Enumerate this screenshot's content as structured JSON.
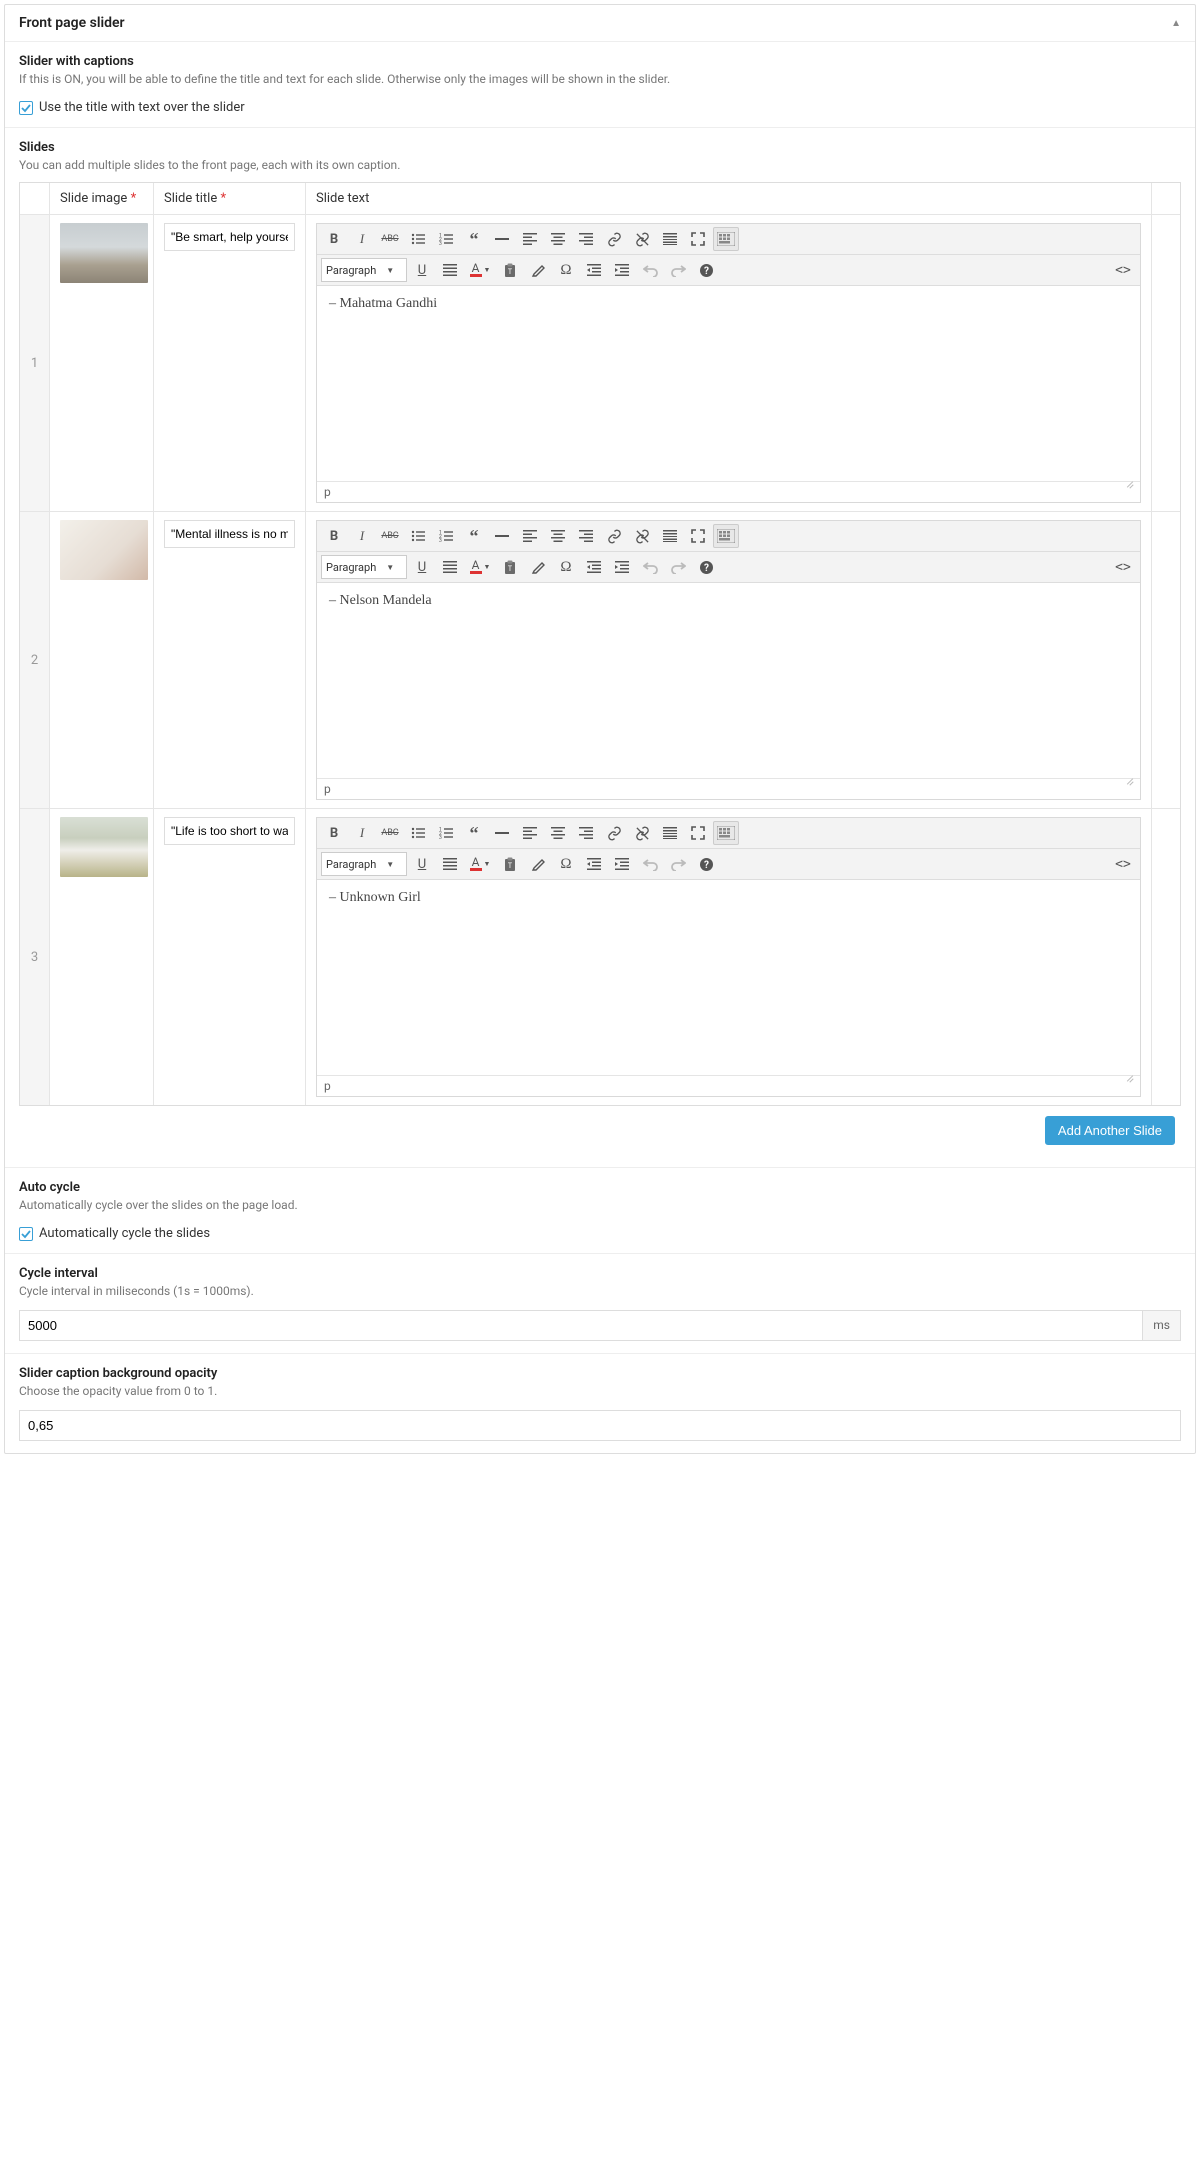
{
  "panel": {
    "title": "Front page slider"
  },
  "captions": {
    "title": "Slider with captions",
    "desc": "If this is ON, you will be able to define the title and text for each slide. Otherwise only the images will be shown in the slider.",
    "cb_label": "Use the title with text over the slider"
  },
  "slides": {
    "title": "Slides",
    "desc": "You can add multiple slides to the front page, each with its own caption.",
    "col_image": "Slide image",
    "col_title": "Slide title",
    "col_text": "Slide text",
    "add_btn": "Add Another Slide",
    "paragraph_label": "Paragraph",
    "path": "p",
    "rows": [
      {
        "idx": "1",
        "title_val": "\"Be smart, help yourse",
        "body": "– Mahatma Gandhi"
      },
      {
        "idx": "2",
        "title_val": "\"Mental illness is no my",
        "body": "– Nelson Mandela"
      },
      {
        "idx": "3",
        "title_val": "\"Life is too short to wai",
        "body": "– Unknown Girl"
      }
    ]
  },
  "auto": {
    "title": "Auto cycle",
    "desc": "Automatically cycle over the slides on the page load.",
    "cb_label": "Automatically cycle the slides"
  },
  "interval": {
    "title": "Cycle interval",
    "desc": "Cycle interval in miliseconds (1s = 1000ms).",
    "value": "5000",
    "unit": "ms"
  },
  "opacity": {
    "title": "Slider caption background opacity",
    "desc": "Choose the opacity value from 0 to 1.",
    "value": "0,65"
  }
}
